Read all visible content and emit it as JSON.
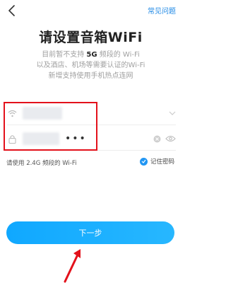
{
  "header": {
    "back_icon": "chevron-left-icon",
    "help_label": "常见问题"
  },
  "title": "请设置音箱WiFi",
  "description": {
    "line1_pre": "目前暂不支持 ",
    "line1_hl": "5G",
    "line1_post": " 频段的 Wi-Fi",
    "line2": "以及酒店、机场等需要认证的Wi-Fi",
    "line3": "新增支持使用手机热点连网"
  },
  "form": {
    "ssid_icon": "wifi-icon",
    "password_icon": "lock-icon",
    "password_value": "•••",
    "dropdown_icon": "chevron-down-icon",
    "clear_icon": "clear-icon",
    "visibility_icon": "eye-icon"
  },
  "hint": "请使用 2.4G 频段的 Wi-Fi",
  "remember_label": "记住密码",
  "remember_checked": true,
  "next_label": "下一步",
  "colors": {
    "accent": "#1e88e5",
    "button": "#10a8ff",
    "highlight_border": "#e3111b",
    "arrow": "#e3111b"
  }
}
